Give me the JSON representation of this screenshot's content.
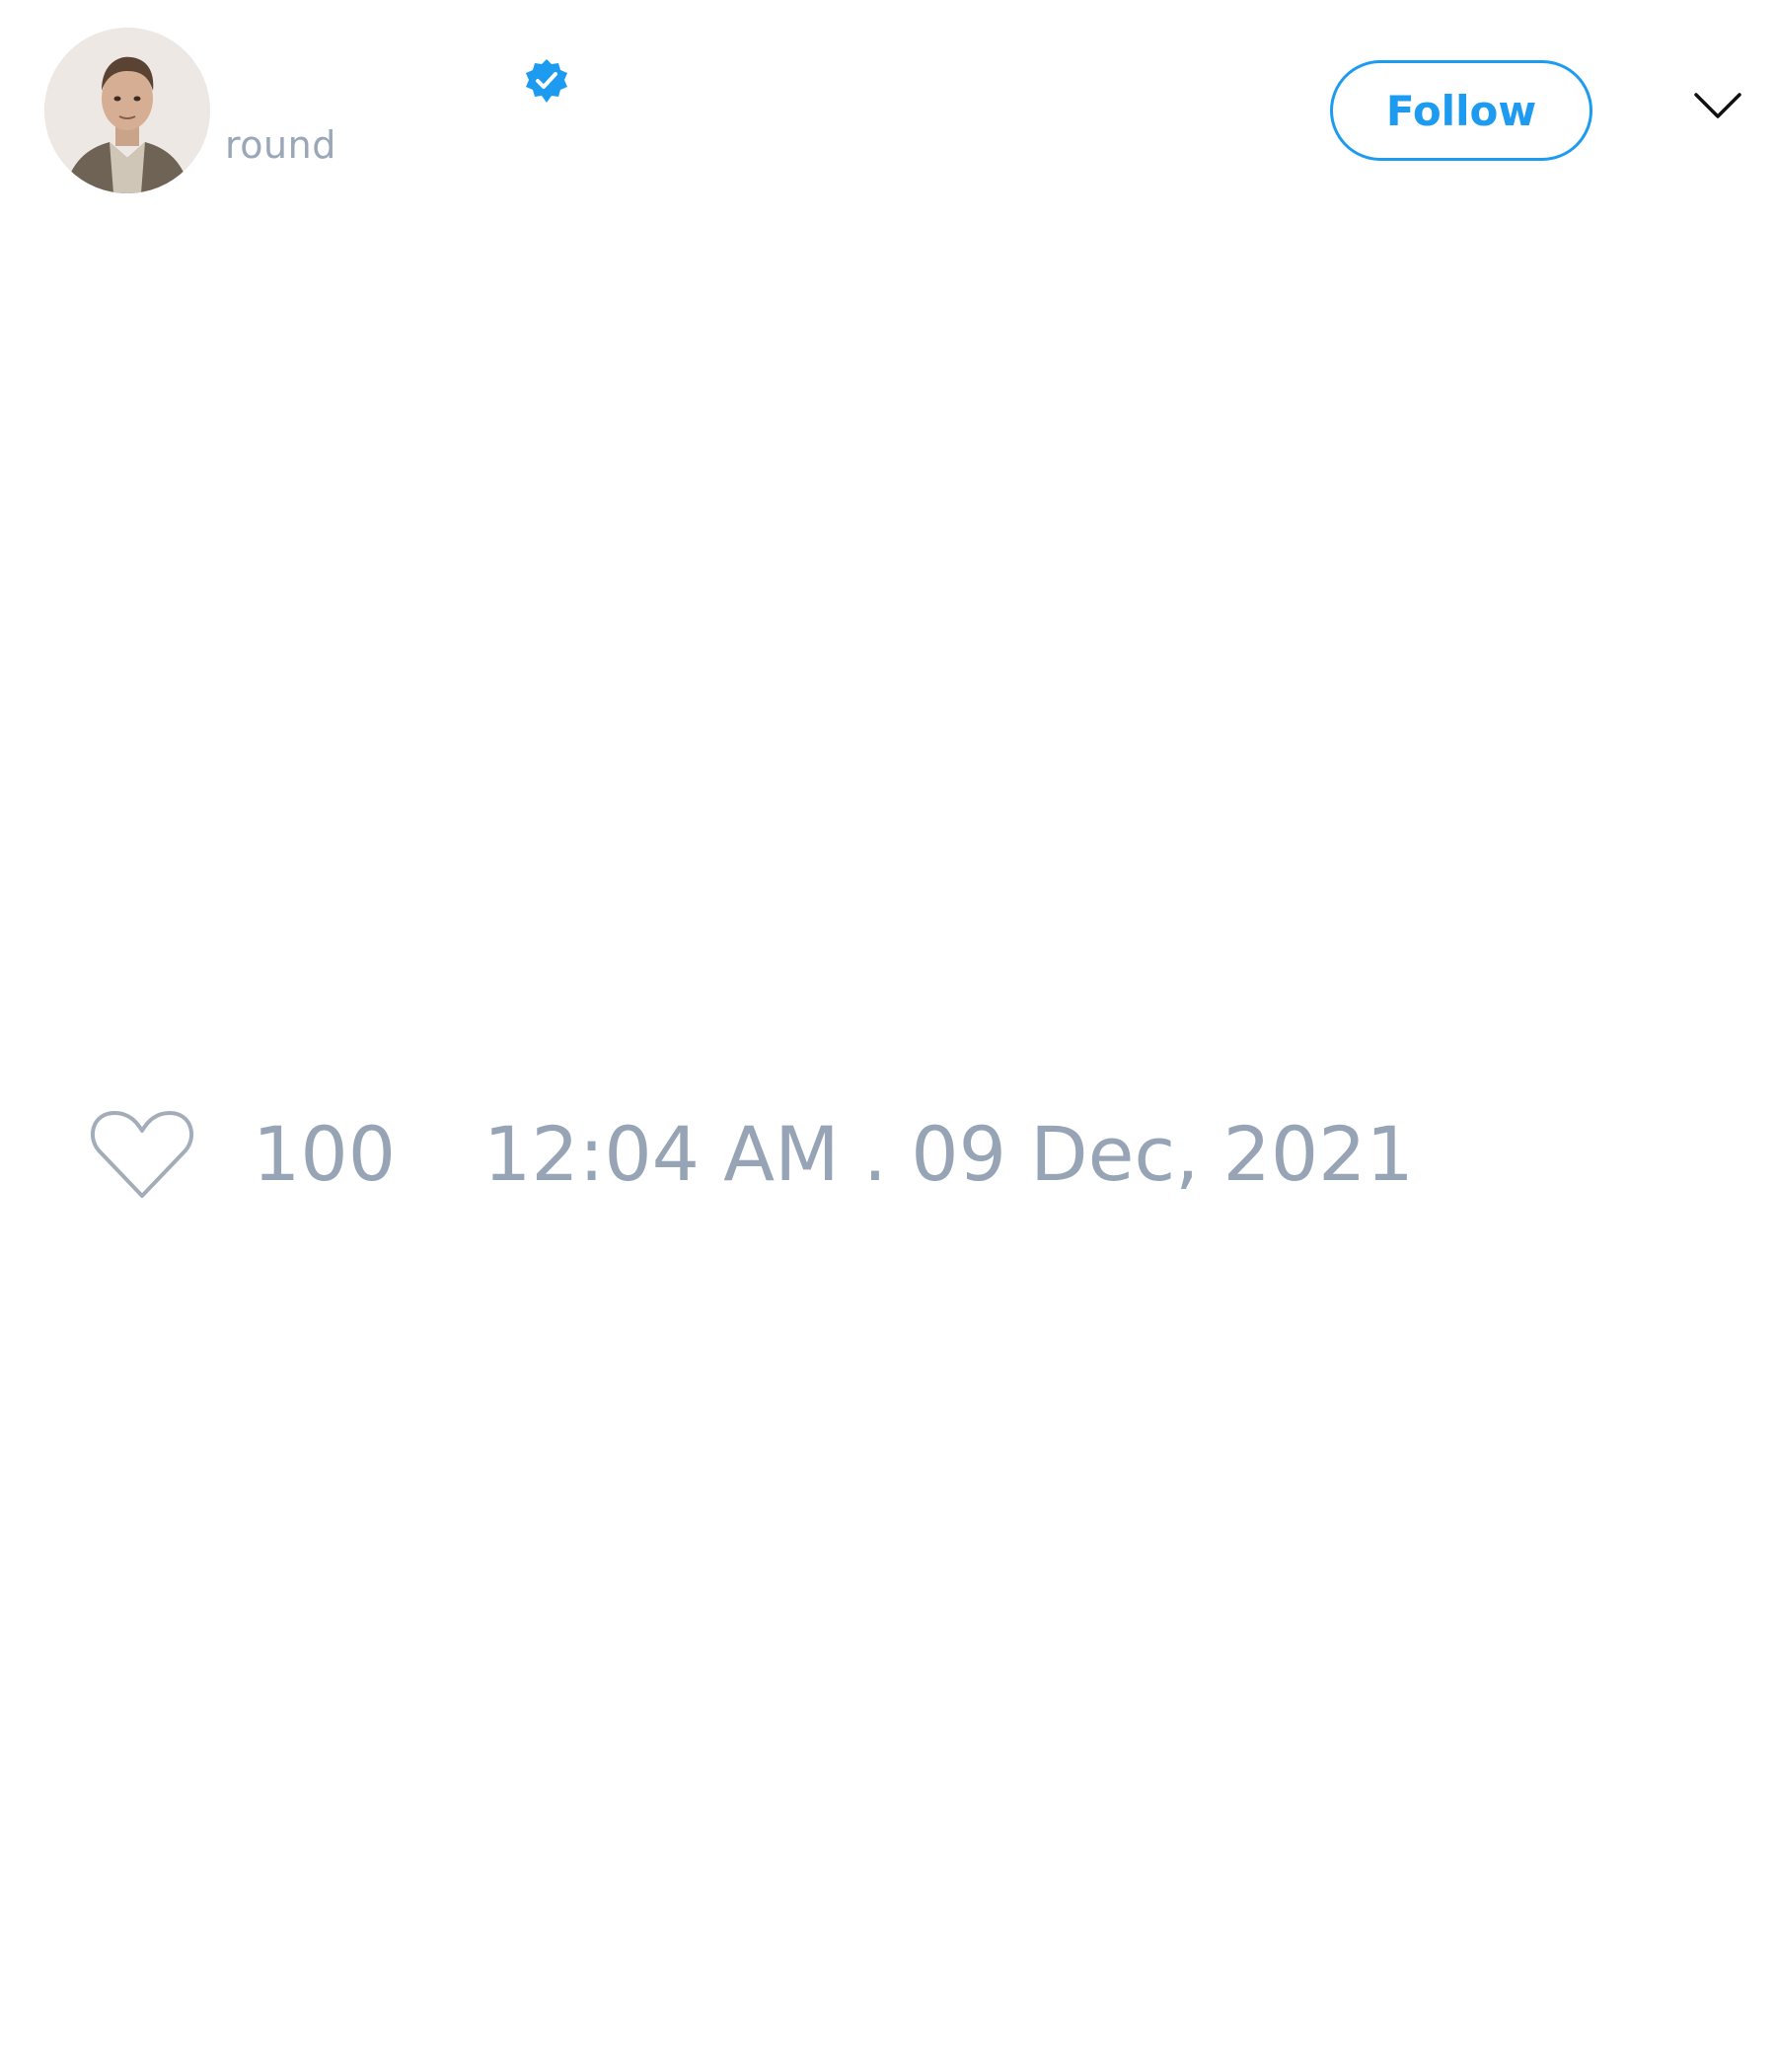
{
  "tweet": {
    "author": {
      "handle": "round",
      "verified": true,
      "avatar_icon": "profile-photo"
    },
    "follow_label": "Follow",
    "menu_icon": "chevron-down-icon",
    "likes": "100",
    "timestamp": "12:04 AM . 09 Dec, 2021"
  },
  "colors": {
    "accent": "#1d9bf0",
    "muted_text": "#97a4b6",
    "background": "#ffffff"
  }
}
